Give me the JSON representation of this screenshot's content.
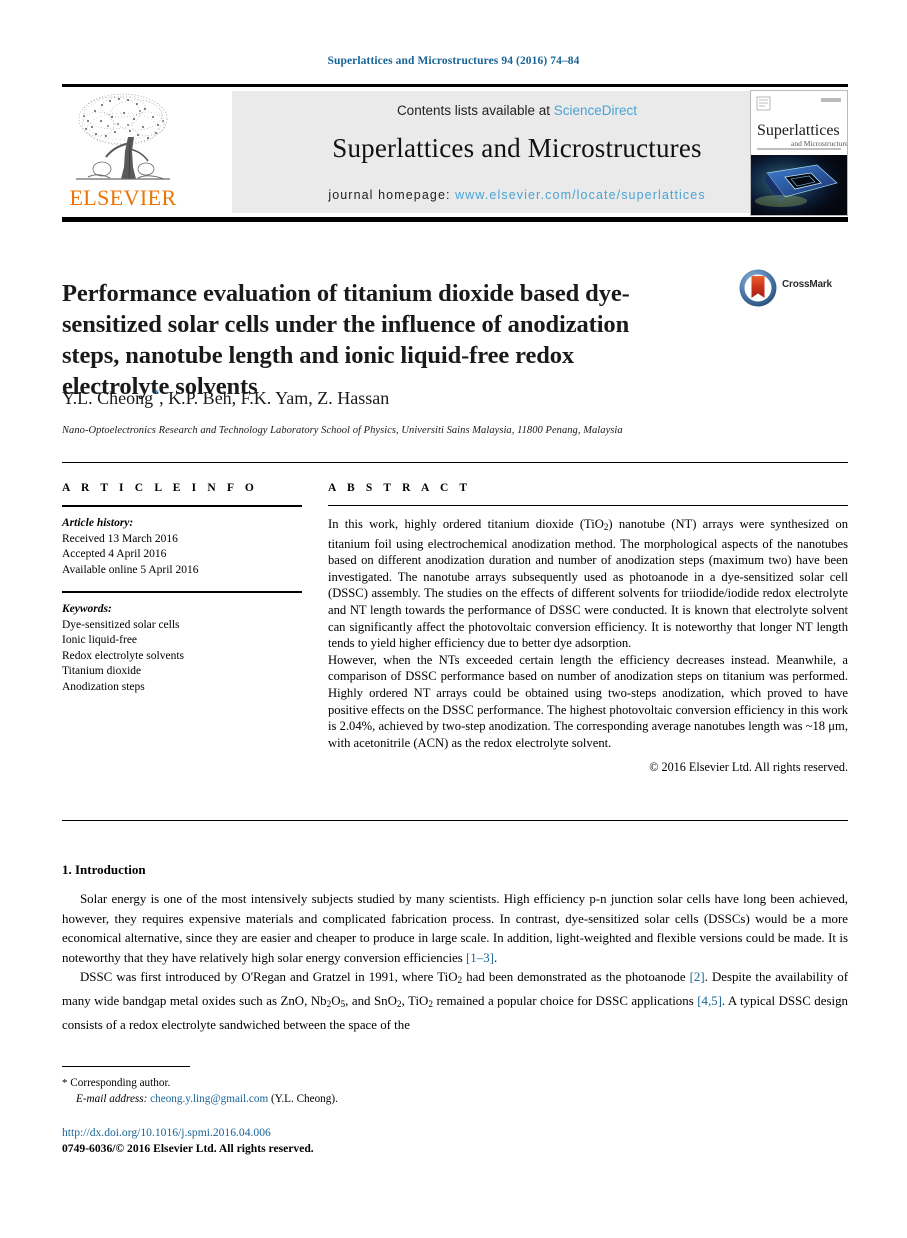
{
  "running_head": "Superlattices and Microstructures 94 (2016) 74–84",
  "masthead": {
    "contents_prefix": "Contents lists available at ",
    "sciencedirect_link": "ScienceDirect",
    "journal_title": "Superlattices and Microstructures",
    "homepage_prefix": "journal homepage: ",
    "homepage_link": "www.elsevier.com/locate/superlattices",
    "publisher_wordmark": "ELSEVIER",
    "publisher_logo_icon": "elsevier-tree-icon",
    "cover_icon": "journal-cover-thumbnail",
    "cover_title": "Superlattices",
    "cover_subtitle": "and Microstructures"
  },
  "article": {
    "title": "Performance evaluation of titanium dioxide based dye-sensitized solar cells under the influence of anodization steps, nanotube length and ionic liquid-free redox electrolyte solvents",
    "authors": "Y.L. Cheong",
    "authors_rest": ", K.P. Beh, F.K. Yam, Z. Hassan",
    "corresponding_marker": "*",
    "affiliation": "Nano-Optoelectronics Research and Technology Laboratory School of Physics, Universiti Sains Malaysia, 11800 Penang, Malaysia",
    "crossmark_label": "CrossMark",
    "crossmark_icon": "crossmark-logo-icon"
  },
  "article_info": {
    "heading": "A R T I C L E   I N F O",
    "history_label": "Article history:",
    "history": [
      "Received 13 March 2016",
      "Accepted 4 April 2016",
      "Available online 5 April 2016"
    ],
    "keywords_label": "Keywords:",
    "keywords": [
      "Dye-sensitized solar cells",
      "Ionic liquid-free",
      "Redox electrolyte solvents",
      "Titanium dioxide",
      "Anodization steps"
    ]
  },
  "abstract": {
    "heading": "A B S T R A C T",
    "paragraph1_a": "In this work, highly ordered titanium dioxide (TiO",
    "paragraph1_b": ") nanotube (NT) arrays were synthesized on titanium foil using electrochemical anodization method. The morphological aspects of the nanotubes based on different anodization duration and number of anodization steps (maximum two) have been investigated. The nanotube arrays subsequently used as photoanode in a dye-sensitized solar cell (DSSC) assembly. The studies on the effects of different solvents for triiodide/iodide redox electrolyte and NT length towards the performance of DSSC were conducted. It is known that electrolyte solvent can significantly affect the photovoltaic conversion efficiency. It is noteworthy that longer NT length tends to yield higher efficiency due to better dye adsorption.",
    "paragraph2": "However, when the NTs exceeded certain length the efficiency decreases instead. Meanwhile, a comparison of DSSC performance based on number of anodization steps on titanium was performed. Highly ordered NT arrays could be obtained using two-steps anodization, which proved to have positive effects on the DSSC performance. The highest photovoltaic conversion efficiency in this work is 2.04%, achieved by two-step anodization. The corresponding average nanotubes length was ~18 μm, with acetonitrile (ACN) as the redox electrolyte solvent.",
    "copyright": "© 2016 Elsevier Ltd. All rights reserved."
  },
  "introduction": {
    "heading": "1. Introduction",
    "p1": "Solar energy is one of the most intensively subjects studied by many scientists. High efficiency p-n junction solar cells have long been achieved, however, they requires expensive materials and complicated fabrication process. In contrast, dye-sensitized solar cells (DSSCs) would be a more economical alternative, since they are easier and cheaper to produce in large scale. In addition, light-weighted and flexible versions could be made. It is noteworthy that they have relatively high solar energy conversion efficiencies ",
    "p1_ref": "[1–3]",
    "p1_end": ".",
    "p2_a": "DSSC was first introduced by O'Regan and Gratzel in 1991, where TiO",
    "p2_b": " had been demonstrated as the photoanode ",
    "p2_ref1": "[2]",
    "p2_c": ". Despite the availability of many wide bandgap metal oxides such as ZnO, Nb",
    "p2_d": "O",
    "p2_e": ", and SnO",
    "p2_f": ", TiO",
    "p2_g": " remained a popular choice for DSSC applications ",
    "p2_ref2": "[4,5]",
    "p2_h": ". A typical DSSC design consists of a redox electrolyte sandwiched between the space of the"
  },
  "footer": {
    "corresponding_star": "*",
    "corresponding_label": "Corresponding author.",
    "email_label": "E-mail address:",
    "email": "cheong.y.ling@gmail.com",
    "email_owner": "(Y.L. Cheong).",
    "doi": "http://dx.doi.org/10.1016/j.spmi.2016.04.006",
    "issn_line": "0749-6036/© 2016 Elsevier Ltd. All rights reserved."
  },
  "colors": {
    "link_blue": "#1a6496",
    "sd_blue": "#4ba3d3",
    "elsevier_orange": "#ec7404",
    "band_grey": "#eaeaea"
  }
}
